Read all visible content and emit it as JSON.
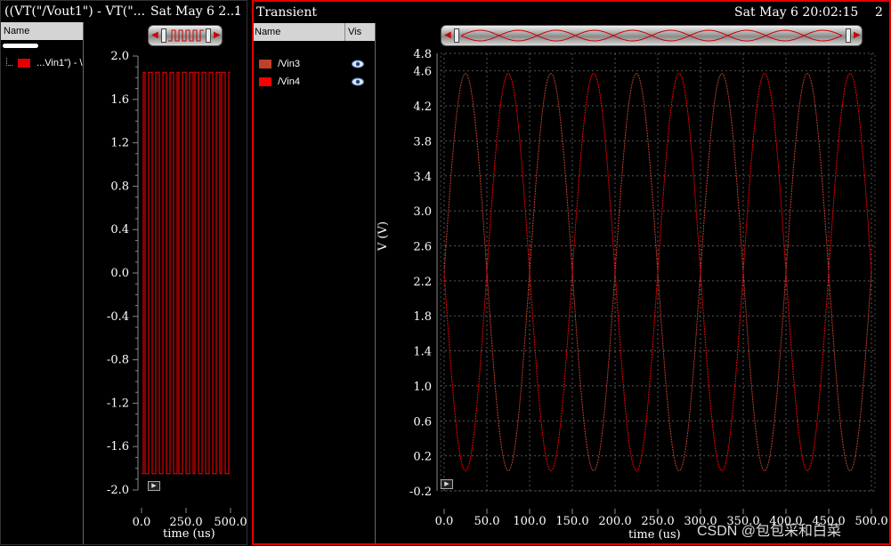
{
  "left": {
    "title": "((VT(\"/Vout1\") - VT(\"...",
    "date": "Sat May 6 2...",
    "index": "1",
    "legend_header": "Name",
    "legend_item": "...Vin1\") - \\",
    "y_ticks": [
      "2.0",
      "1.6",
      "1.2",
      "0.8",
      "0.4",
      "0.0",
      "-0.4",
      "-0.8",
      "-1.2",
      "-1.6",
      "-2.0"
    ],
    "x_ticks": [
      "0.0",
      "250.0",
      "500.0"
    ],
    "x_label": "time (us)"
  },
  "right": {
    "title": "Transient",
    "date": "Sat May 6 20:02:15",
    "index": "2",
    "legend_name_header": "Name",
    "legend_vis_header": "Vis",
    "legend_items": [
      {
        "name": "/Vin3",
        "color": "#c0402a",
        "icon": "eye-icon"
      },
      {
        "name": "/Vin4",
        "color": "#ff0000",
        "icon": "eye-icon"
      }
    ],
    "y_label": "V (V)",
    "x_label": "time (us)",
    "y_ticks": [
      "4.8",
      "4.6",
      "4.2",
      "3.8",
      "3.4",
      "3.0",
      "2.6",
      "2.2",
      "1.8",
      "1.4",
      "1.0",
      "0.6",
      "0.2",
      "-0.2"
    ],
    "x_ticks": [
      "0.0",
      "50.0",
      "100.0",
      "150.0",
      "200.0",
      "250.0",
      "300.0",
      "350.0",
      "400.0",
      "450.0",
      "500.0"
    ]
  },
  "watermark": "CSDN @包包采和白菜",
  "colors": {
    "trace": "#e00000",
    "frame": "#e00000"
  },
  "chart_data": [
    {
      "type": "line",
      "title": "",
      "xlabel": "time (us)",
      "ylabel": "",
      "xlim": [
        0,
        500
      ],
      "ylim": [
        -2.0,
        2.0
      ],
      "series": [
        {
          "x": [
            0,
            10,
            10,
            20,
            20,
            40,
            40,
            60,
            60,
            80,
            80,
            100,
            100,
            120,
            120,
            140,
            140,
            160,
            160,
            180,
            180,
            200,
            200,
            210,
            210,
            230,
            230,
            250,
            250,
            270,
            270,
            290,
            290,
            300,
            300,
            320,
            320,
            340,
            340,
            360,
            360,
            380,
            380,
            400,
            400,
            420,
            420,
            440,
            440,
            450,
            450,
            470,
            470,
            490,
            490,
            500
          ],
          "y": [
            -1.85,
            -1.85,
            1.85,
            1.85,
            -1.85,
            -1.85,
            1.85,
            1.85,
            -1.85,
            -1.85,
            1.85,
            1.85,
            -1.85,
            -1.85,
            1.85,
            1.85,
            -1.85,
            -1.85,
            1.85,
            1.85,
            -1.85,
            -1.85,
            1.85,
            1.85,
            -1.85,
            -1.85,
            1.85,
            1.85,
            -1.85,
            -1.85,
            1.85,
            1.85,
            -1.85,
            -1.85,
            1.85,
            1.85,
            -1.85,
            -1.85,
            1.85,
            1.85,
            -1.85,
            -1.85,
            1.85,
            1.85,
            -1.85,
            -1.85,
            1.85,
            1.85,
            -1.85,
            -1.85,
            1.85,
            1.85,
            -1.85,
            -1.85,
            1.85,
            1.85
          ]
        }
      ]
    },
    {
      "type": "line",
      "title": "Transient",
      "xlabel": "time (us)",
      "ylabel": "V (V)",
      "xlim": [
        0,
        500
      ],
      "ylim": [
        -0.2,
        4.8
      ],
      "grid": true,
      "sine": {
        "offset": 2.3,
        "amplitude": 2.27,
        "period_us": 100
      },
      "series": [
        {
          "name": "/Vin3",
          "phase_deg": 0
        },
        {
          "name": "/Vin4",
          "phase_deg": 180
        }
      ]
    }
  ]
}
